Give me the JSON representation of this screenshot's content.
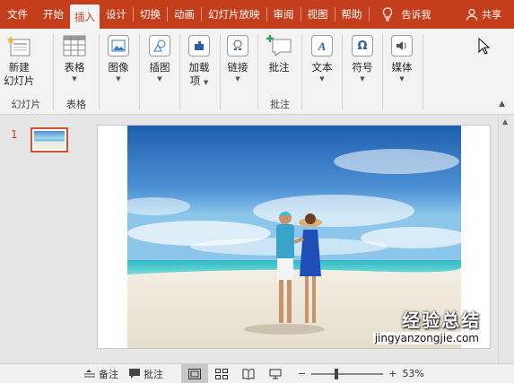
{
  "tabs": [
    "文件",
    "开始",
    "插入",
    "设计",
    "切换",
    "动画",
    "幻灯片放映",
    "审阅",
    "视图",
    "帮助"
  ],
  "active_tab": "插入",
  "tell_me": "告诉我",
  "share": "共享",
  "ribbon": {
    "new_slide": {
      "line1": "新建",
      "line2": "幻灯片"
    },
    "slides_group": "幻灯片",
    "table": "表格",
    "tables_group": "表格",
    "image": "图像",
    "illustrations": "插图",
    "addins": {
      "line1": "加载",
      "line2": "项"
    },
    "links": "链接",
    "comment": "批注",
    "comments_group": "批注",
    "text": "文本",
    "symbols": "符号",
    "media": "媒体"
  },
  "slide_number": "1",
  "status": {
    "notes": "备注",
    "comments": "批注",
    "zoom": "53%"
  },
  "watermark": {
    "line1": "经验总结",
    "line2": "jingyanzongjie.com"
  },
  "colors": {
    "accent": "#c43e1c",
    "ribbon_bg": "#f3f3f3",
    "pane_bg": "#e6e6e6"
  }
}
